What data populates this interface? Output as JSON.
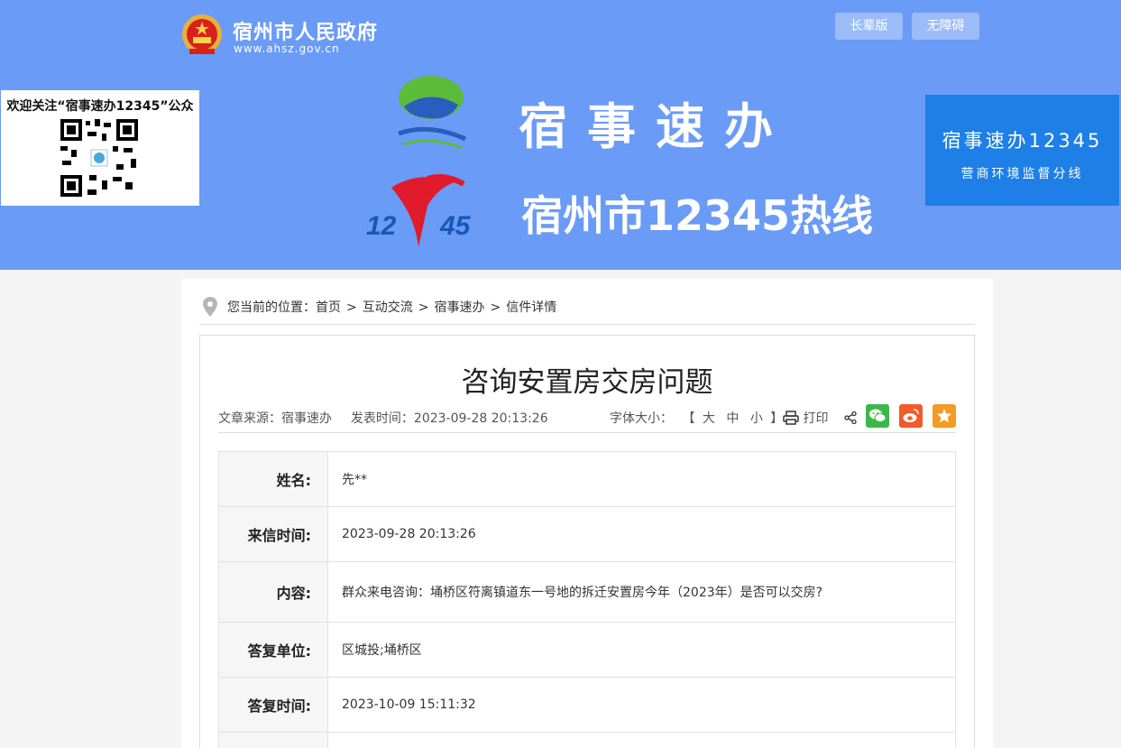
{
  "header": {
    "site_title": "宿州市人民政府",
    "site_url": "www.ahsz.gov.cn",
    "buttons": {
      "elder": "长辈版",
      "accessible": "无障碍"
    },
    "qr_caption": "欢迎关注“宿事速办12345”公众号",
    "banner_line1": "宿事速办",
    "banner_line2": "宿州市12345热线",
    "side_card": {
      "line1": "宿事速办12345",
      "line2": "营商环境监督分线"
    }
  },
  "breadcrumb": {
    "prefix": "您当前的位置：",
    "items": [
      "首页",
      "互动交流",
      "宿事速办",
      "信件详情"
    ],
    "separator": ">"
  },
  "article": {
    "title": "咨询安置房交房问题",
    "source_label": "文章来源：",
    "source": "宿事速办",
    "time_label": "发表时间：",
    "time": "2023-09-28 20:13:26",
    "font_size_label": "字体大小：",
    "font_size_open": "【",
    "font_size_options": [
      "大",
      "中",
      "小"
    ],
    "font_size_close": "】",
    "print_label": "打印"
  },
  "letter": {
    "rows": [
      {
        "label": "姓名:",
        "value": "先**"
      },
      {
        "label": "来信时间:",
        "value": "2023-09-28 20:13:26"
      },
      {
        "label": "内容:",
        "value": "群众来电咨询：埇桥区符离镇道东一号地的拆迁安置房今年（2023年）是否可以交房?"
      },
      {
        "label": "答复单位:",
        "value": "区城投;埇桥区"
      },
      {
        "label": "答复时间:",
        "value": "2023-10-09 15:11:32"
      }
    ]
  },
  "colors": {
    "header_bg": "#6a9bf7",
    "side_card_bg": "#1e7fe6",
    "wechat": "#3bb84a",
    "weibo": "#f15a2b",
    "favorite": "#f59a23"
  }
}
